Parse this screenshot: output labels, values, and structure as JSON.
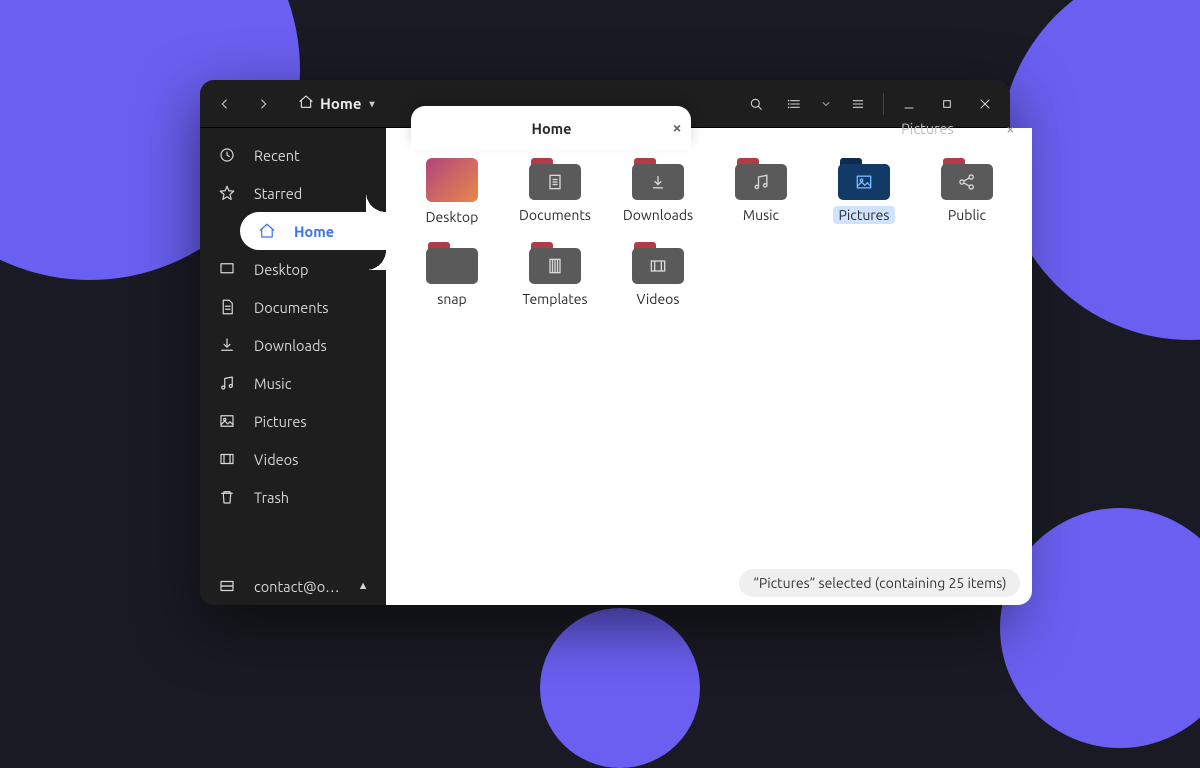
{
  "breadcrumb": {
    "label": "Home"
  },
  "tabs": {
    "active": {
      "label": "Home"
    },
    "inactive": {
      "label": "Pictures"
    }
  },
  "sidebar": {
    "items": [
      {
        "label": "Recent"
      },
      {
        "label": "Starred"
      },
      {
        "label": "Home"
      },
      {
        "label": "Desktop"
      },
      {
        "label": "Documents"
      },
      {
        "label": "Downloads"
      },
      {
        "label": "Music"
      },
      {
        "label": "Pictures"
      },
      {
        "label": "Videos"
      },
      {
        "label": "Trash"
      }
    ],
    "mount": {
      "label": "contact@o…"
    }
  },
  "files": [
    {
      "name": "Desktop",
      "kind": "desktop"
    },
    {
      "name": "Documents",
      "kind": "folder",
      "glyph": "doc"
    },
    {
      "name": "Downloads",
      "kind": "folder",
      "glyph": "download"
    },
    {
      "name": "Music",
      "kind": "folder",
      "glyph": "music"
    },
    {
      "name": "Pictures",
      "kind": "folder",
      "glyph": "image",
      "selected": true
    },
    {
      "name": "Public",
      "kind": "folder",
      "glyph": "share"
    },
    {
      "name": "snap",
      "kind": "folder",
      "glyph": ""
    },
    {
      "name": "Templates",
      "kind": "folder",
      "glyph": "template"
    },
    {
      "name": "Videos",
      "kind": "folder",
      "glyph": "video"
    }
  ],
  "status": {
    "text": "“Pictures” selected  (containing 25 items)"
  }
}
